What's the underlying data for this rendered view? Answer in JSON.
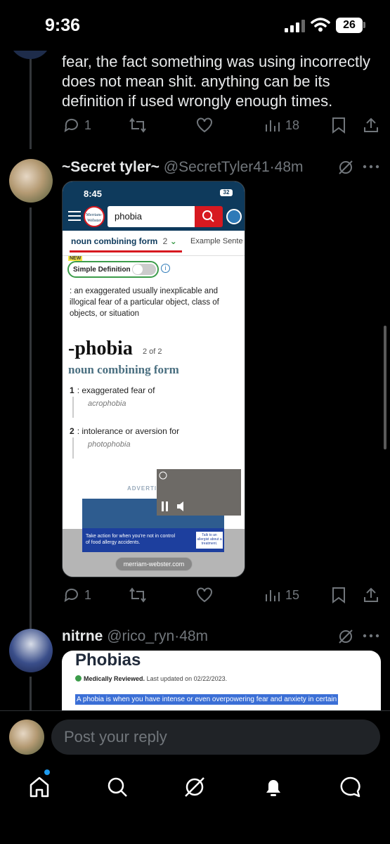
{
  "status": {
    "time": "9:36",
    "battery": "26"
  },
  "tweet1": {
    "text": "fear, the fact something was using incorrectly does not mean shit. anything can be its definition if used wrongly enough times.",
    "replies": "1",
    "views": "18"
  },
  "tweet2": {
    "name": "~Secret tyler~",
    "handle": "@SecretTyler41",
    "sep": "·",
    "time": "48m",
    "replies": "1",
    "views": "15",
    "embed": {
      "time": "8:45",
      "battery": "32",
      "logo": "Merriam-Webster",
      "search_value": "phobia",
      "tab_active": "noun combining form",
      "tab_count": "2",
      "tab_other": "Example Sente",
      "new_badge": "NEW",
      "simple_label": "Simple Definition",
      "definition": ": an exaggerated usually inexplicable and illogical fear of a particular object, class of objects, or situation",
      "headword": "-phobia",
      "headword_count": "2 of 2",
      "part_of_speech": "noun combining form",
      "sense1_num": "1",
      "sense1": ": exaggerated fear of",
      "sense1_example": "acrophobia",
      "sense2_num": "2",
      "sense2": ": intolerance or aversion for",
      "sense2_example": "photophobia",
      "ad_label": "ADVERTIS",
      "ad_text": "Take action for when you're not in control of food allergy accidents.",
      "ad_button": "Talk to an allergist about a treatment.",
      "url": "merriam-webster.com"
    }
  },
  "tweet3": {
    "name": "nitrne",
    "handle": "@rico_ryn",
    "sep": "·",
    "time": "48m",
    "embed": {
      "title": "Phobias",
      "reviewed": "Medically Reviewed.",
      "updated": "Last updated on 02/22/2023.",
      "highlight": "A phobia is when you have intense or even overpowering fear and anxiety in certain"
    }
  },
  "reply": {
    "placeholder": "Post your reply"
  },
  "colors": {
    "accent": "#1d9bf0",
    "background": "#000000",
    "muted": "#71767b"
  }
}
